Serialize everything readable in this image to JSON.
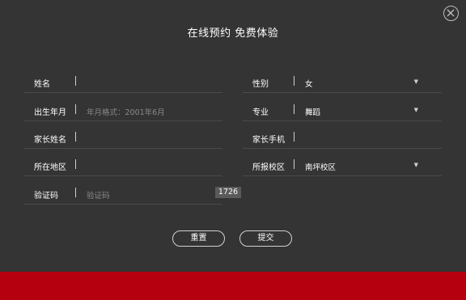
{
  "dialog": {
    "title": "在线预约 免费体验",
    "close_icon": "close-icon"
  },
  "form": {
    "name": {
      "label": "姓名",
      "value": ""
    },
    "gender": {
      "label": "性别",
      "value": "女"
    },
    "birth": {
      "label": "出生年月",
      "placeholder": "年月格式：2001年6月"
    },
    "major": {
      "label": "专业",
      "value": "舞蹈"
    },
    "parent_name": {
      "label": "家长姓名",
      "value": ""
    },
    "parent_phone": {
      "label": "家长手机",
      "value": ""
    },
    "region": {
      "label": "所在地区",
      "value": ""
    },
    "campus": {
      "label": "所报校区",
      "value": "南坪校区"
    },
    "captcha": {
      "label": "验证码",
      "placeholder": "验证码",
      "code": "1726"
    }
  },
  "buttons": {
    "reset": "重置",
    "submit": "提交"
  },
  "colors": {
    "background": "#343434",
    "footer": "#b5000f"
  }
}
